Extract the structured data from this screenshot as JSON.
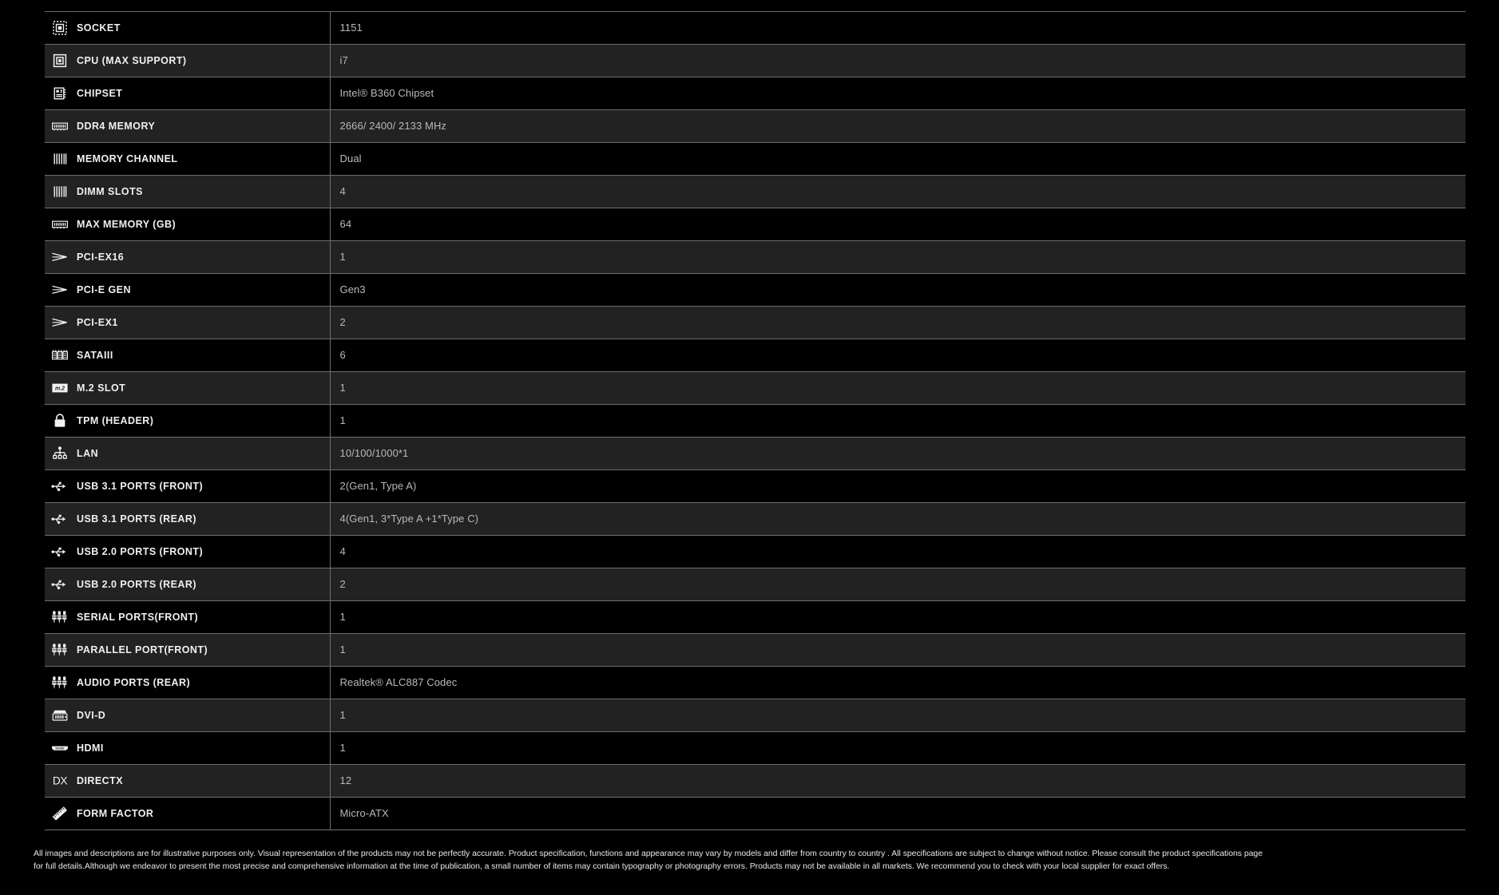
{
  "table": {
    "rows": [
      {
        "icon": "cpu-socket-icon",
        "label": "SOCKET",
        "value": "1151"
      },
      {
        "icon": "cpu-chip-icon",
        "label": "CPU (MAX SUPPORT)",
        "value": "i7"
      },
      {
        "icon": "chipset-icon",
        "label": "CHIPSET",
        "value": "Intel® B360 Chipset"
      },
      {
        "icon": "memory-module-icon",
        "label": "DDR4 MEMORY",
        "value": "2666/ 2400/ 2133 MHz"
      },
      {
        "icon": "memory-channel-icon",
        "label": "MEMORY CHANNEL",
        "value": "Dual"
      },
      {
        "icon": "dimm-slots-icon",
        "label": "DIMM SLOTS",
        "value": "4"
      },
      {
        "icon": "memory-module-icon",
        "label": "MAX MEMORY (GB)",
        "value": "64"
      },
      {
        "icon": "pcie-arrow-icon",
        "label": "PCI-EX16",
        "value": "1"
      },
      {
        "icon": "pcie-arrow-icon",
        "label": "PCI-E GEN",
        "value": "Gen3"
      },
      {
        "icon": "pcie-arrow-icon",
        "label": "PCI-EX1",
        "value": "2"
      },
      {
        "icon": "sata-connector-icon",
        "label": "SATAIII",
        "value": "6"
      },
      {
        "icon": "m2-slot-icon",
        "label": "M.2 SLOT",
        "value": "1"
      },
      {
        "icon": "lock-icon",
        "label": "TPM (HEADER)",
        "value": "1"
      },
      {
        "icon": "network-lan-icon",
        "label": "LAN",
        "value": "10/100/1000*1"
      },
      {
        "icon": "usb-icon",
        "label": "USB 3.1 PORTS (FRONT)",
        "value": "2(Gen1, Type A)"
      },
      {
        "icon": "usb-icon",
        "label": "USB 3.1 PORTS (REAR)",
        "value": "4(Gen1, 3*Type A +1*Type C)"
      },
      {
        "icon": "usb-icon",
        "label": "USB 2.0 PORTS (FRONT)",
        "value": "4"
      },
      {
        "icon": "usb-icon",
        "label": "USB 2.0 PORTS (REAR)",
        "value": "2"
      },
      {
        "icon": "audio-jacks-icon",
        "label": "SERIAL PORTS(FRONT)",
        "value": "1"
      },
      {
        "icon": "audio-jacks-icon",
        "label": "PARALLEL PORT(FRONT)",
        "value": "1"
      },
      {
        "icon": "audio-jacks-icon",
        "label": "AUDIO PORTS (REAR)",
        "value": "Realtek® ALC887 Codec"
      },
      {
        "icon": "dvi-port-icon",
        "label": "DVI-D",
        "value": "1"
      },
      {
        "icon": "hdmi-port-icon",
        "label": "HDMI",
        "value": "1"
      },
      {
        "icon": "directx-icon",
        "label": "DIRECTX",
        "value": "12"
      },
      {
        "icon": "form-factor-ruler-icon",
        "label": "FORM FACTOR",
        "value": "Micro-ATX"
      }
    ]
  },
  "footer": {
    "line1": "All images and descriptions are for illustrative purposes only. Visual representation of the products may not be perfectly accurate. Product specification, functions and appearance may vary by models and differ from country to country . All specifications are subject to change without notice. Please consult the product specifications page",
    "line2": "for full details.Although we endeavor to present the most precise and comprehensive information at the time of publication, a small number of items may contain typography or photography errors. Products may not be available in all markets. We recommend you to check with your local supplier for exact offers."
  },
  "colors": {
    "background": "#000000",
    "row_alt": "#222222",
    "border": "#6e6e6e",
    "label_text": "#f0f0f0",
    "value_text": "#b9b9b9"
  }
}
